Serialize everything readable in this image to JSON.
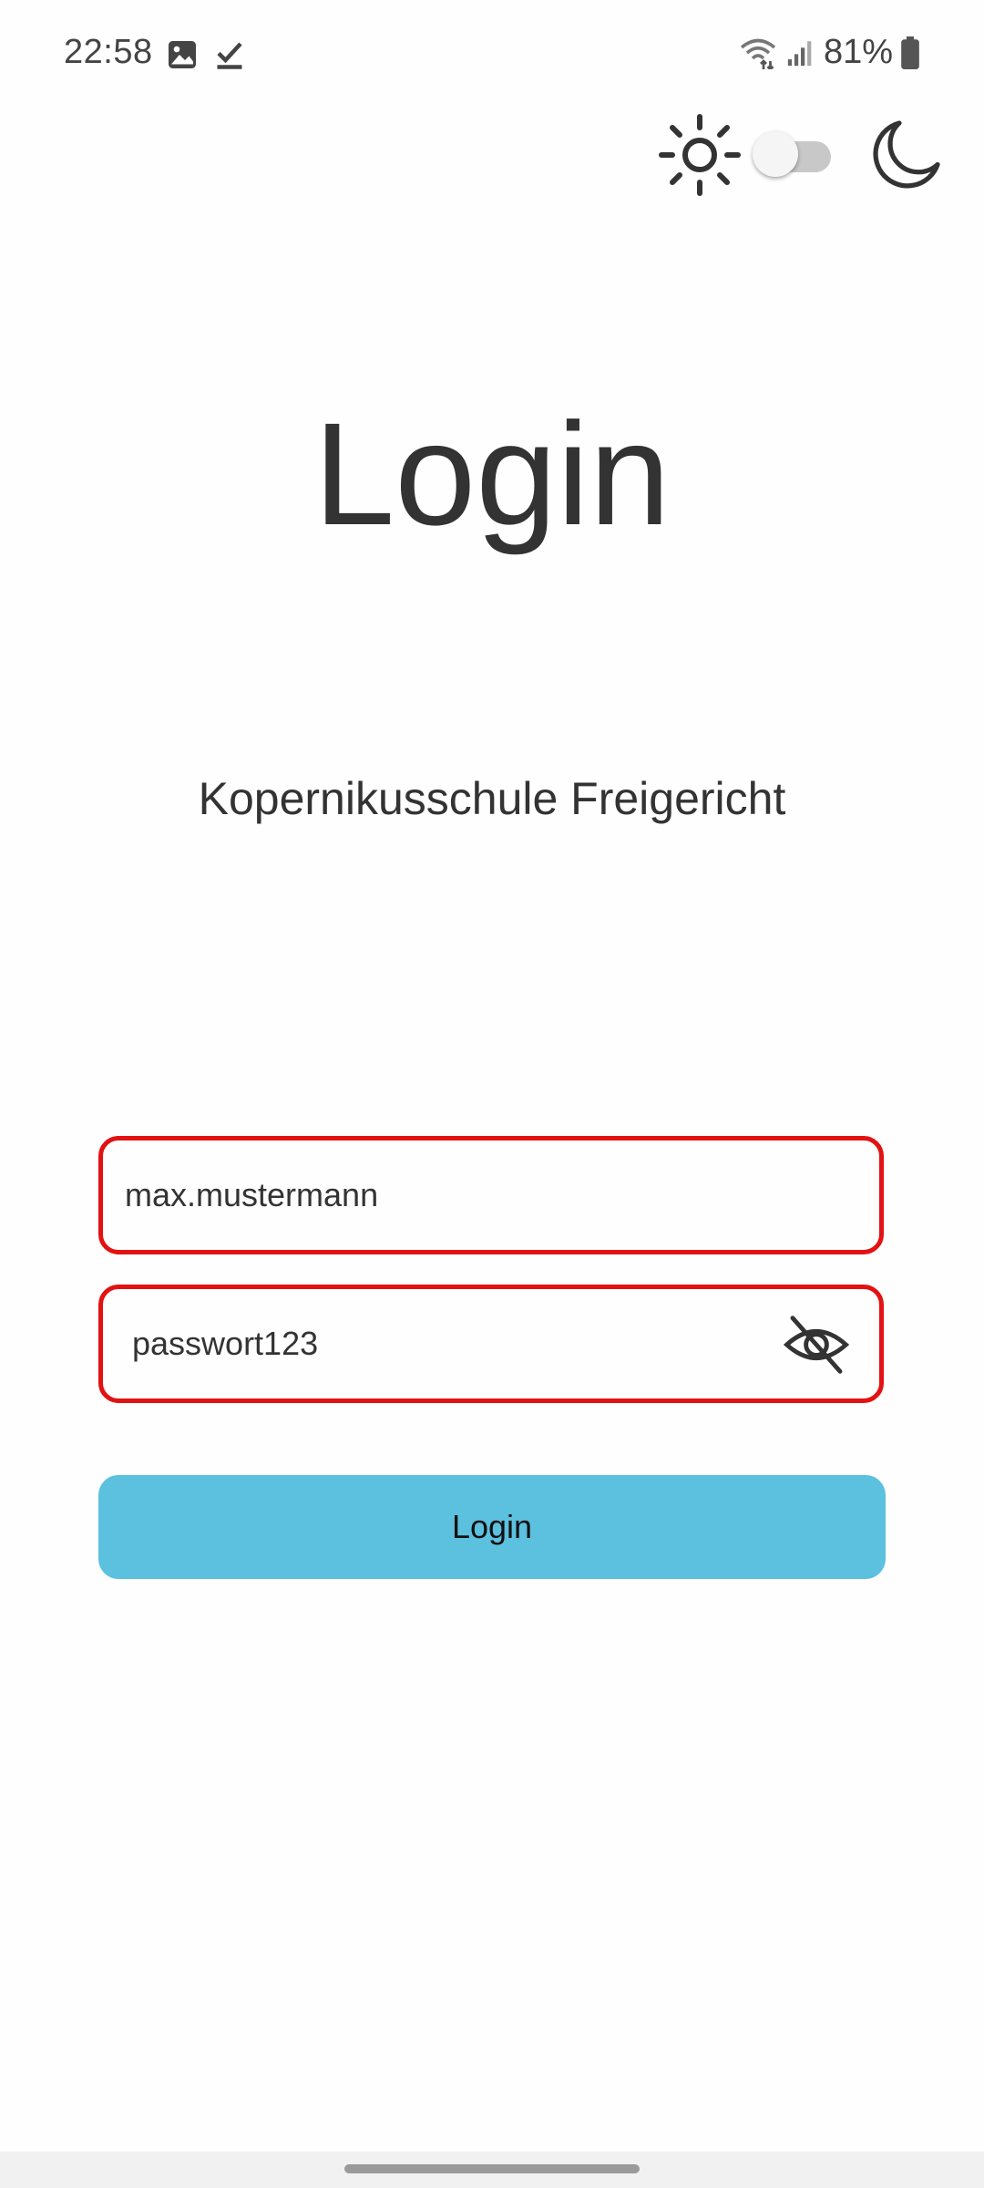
{
  "status_bar": {
    "time": "22:58",
    "battery_percent": "81%",
    "left_icons": [
      "image-icon",
      "check-icon"
    ],
    "right_icons": [
      "wifi-icon",
      "signal-icon",
      "battery-icon"
    ]
  },
  "theme": {
    "dark_mode_enabled": false,
    "icons": [
      "sun-icon",
      "moon-icon"
    ]
  },
  "page": {
    "title": "Login",
    "subtitle": "Kopernikusschule Freigericht"
  },
  "form": {
    "username_value": "max.mustermann",
    "password_value": "passwort123",
    "password_visibility_icon": "eye-off-icon",
    "login_button_label": "Login"
  },
  "colors": {
    "field_error_border": "#e31212",
    "button_background": "#5cc0df",
    "text": "#333333"
  }
}
